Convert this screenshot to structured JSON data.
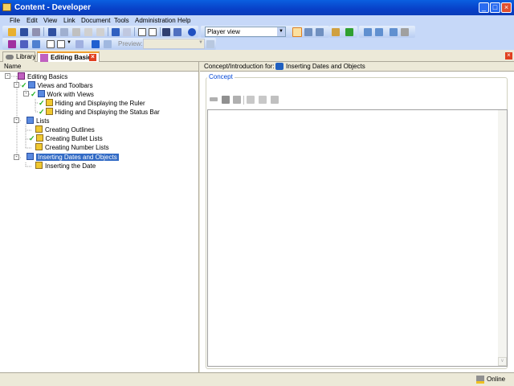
{
  "window": {
    "title": "Content - Developer",
    "controls": [
      "minimize",
      "maximize",
      "close"
    ]
  },
  "menu": [
    "File",
    "Edit",
    "View",
    "Link",
    "Document",
    "Tools",
    "Administration",
    "Help"
  ],
  "toolbar": {
    "view_select": "Player view",
    "preview_label": "Preview:",
    "preview_value": ""
  },
  "tabs": [
    {
      "label": "Library",
      "active": false
    },
    {
      "label": "Editing Basics",
      "active": true,
      "closable": true
    }
  ],
  "tree": {
    "header": "Name",
    "items": [
      {
        "label": "Editing Basics",
        "level": 0,
        "type": "root",
        "checked": false
      },
      {
        "label": "Views and Toolbars",
        "level": 1,
        "type": "book",
        "checked": true
      },
      {
        "label": "Work with Views",
        "level": 2,
        "type": "book",
        "checked": true
      },
      {
        "label": "Hiding and Displaying the Ruler",
        "level": 3,
        "type": "topic",
        "checked": true
      },
      {
        "label": "Hiding and Displaying the Status Bar",
        "level": 3,
        "type": "topic",
        "checked": true
      },
      {
        "label": "Lists",
        "level": 1,
        "type": "book",
        "checked": false
      },
      {
        "label": "Creating Outlines",
        "level": 2,
        "type": "topic",
        "checked": false
      },
      {
        "label": "Creating Bullet Lists",
        "level": 2,
        "type": "topic",
        "checked": true
      },
      {
        "label": "Creating Number Lists",
        "level": 2,
        "type": "topic",
        "checked": false
      },
      {
        "label": "Inserting Dates and Objects",
        "level": 1,
        "type": "book",
        "checked": false,
        "selected": true
      },
      {
        "label": "Inserting the Date",
        "level": 2,
        "type": "topic",
        "checked": false
      }
    ]
  },
  "concept": {
    "header_label": "Concept/Introduction for:",
    "header_value": "Inserting Dates and Objects",
    "group_label": "Concept"
  },
  "status": {
    "connection": "Online"
  }
}
